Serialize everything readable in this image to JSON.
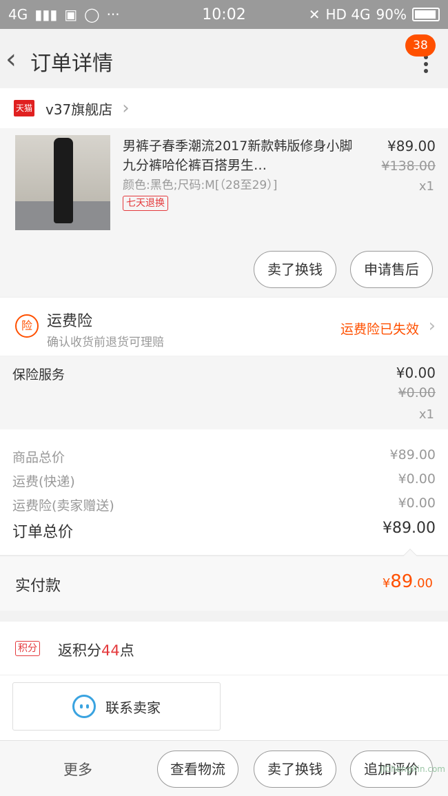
{
  "status_bar": {
    "network_left": "4G",
    "time": "10:02",
    "network_right": "HD 4G",
    "battery": "90%"
  },
  "nav": {
    "title": "订单详情",
    "badge": "38"
  },
  "shop": {
    "logo_text": "天猫",
    "name": "v37旗舰店"
  },
  "product": {
    "title": "男裤子春季潮流2017新款韩版修身小脚九分裤哈伦裤百搭男生…",
    "attributes": "颜色:黑色;尺码:M[（28至29）]",
    "tag": "七天退换",
    "price": "¥89.00",
    "original_price": "¥138.00",
    "quantity": "x1",
    "buttons": {
      "sell": "卖了换钱",
      "after_sale": "申请售后"
    }
  },
  "freight_insurance": {
    "icon_text": "险",
    "title": "运费险",
    "subtitle": "确认收货前退货可理赔",
    "status": "运费险已失效"
  },
  "insurance_service": {
    "title": "保险服务",
    "price": "¥0.00",
    "original_price": "¥0.00",
    "quantity": "x1"
  },
  "summary": {
    "rows": [
      {
        "label": "商品总价",
        "value": "¥89.00"
      },
      {
        "label": "运费(快递)",
        "value": "¥0.00"
      },
      {
        "label": "运费险(卖家赠送)",
        "value": "¥0.00"
      }
    ],
    "total_label": "订单总价",
    "total_value": "¥89.00"
  },
  "paid": {
    "label": "实付款",
    "currency": "¥",
    "integer": "89",
    "decimal": ".00"
  },
  "points": {
    "tag": "积分",
    "prefix": "返积分",
    "number": "44",
    "suffix": "点"
  },
  "contact": {
    "label": "联系卖家"
  },
  "bottom_bar": {
    "more": "更多",
    "logistics": "查看物流",
    "sell": "卖了换钱",
    "review": "追加评价"
  },
  "watermark": "JiChengXin.com"
}
